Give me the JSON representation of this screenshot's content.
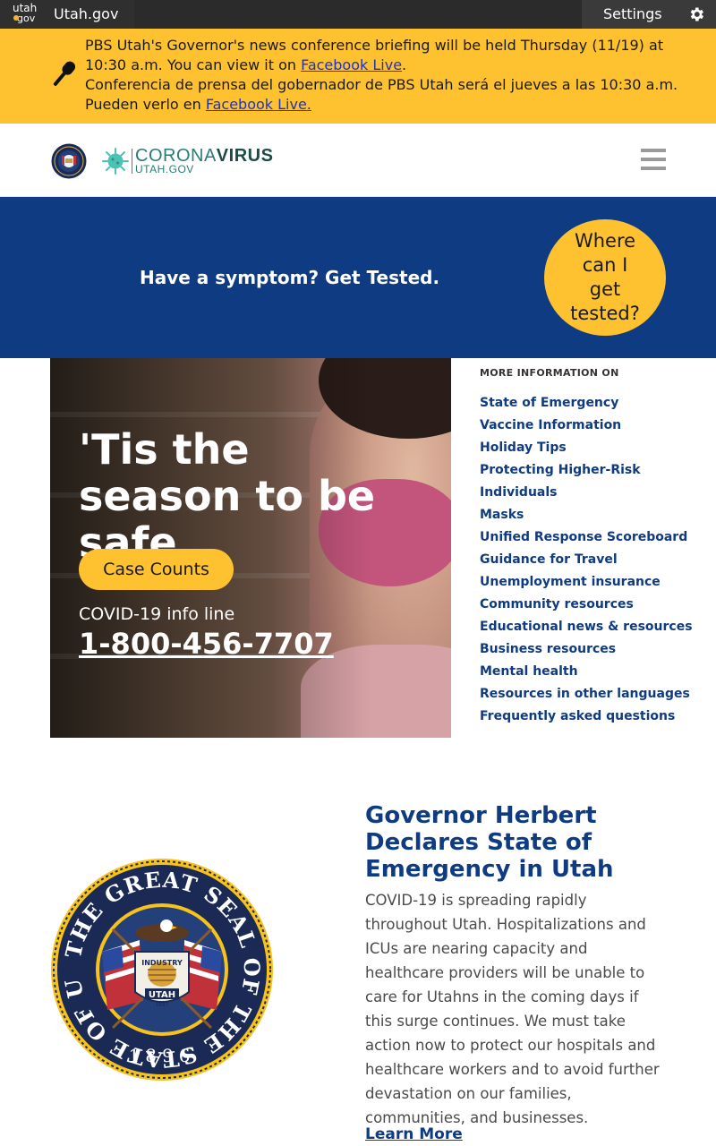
{
  "topbar": {
    "logo_line1": "utah",
    "logo_line2": "gov",
    "site_link": "Utah.gov",
    "settings_label": "Settings"
  },
  "alert": {
    "icon": "microphone-icon",
    "en_text": "PBS Utah's Governor's news conference briefing will be held Thursday (11/19) at 10:30 a.m. You can view it on ",
    "en_link": "Facebook Live",
    "en_suffix": ".",
    "es_text": "Conferencia de prensa del gobernador de PBS Utah será el jueves a las 10:30 a.m. Pueden verlo en ",
    "es_link": "Facebook Live."
  },
  "header": {
    "brand_corona": "CORONA",
    "brand_virus": "VIRUS",
    "brand_sub": "UTAH.GOV"
  },
  "symptom": {
    "text": "Have a symptom? Get Tested.",
    "button": "Where can I get tested?"
  },
  "hero": {
    "title": "'Tis the season to be safe",
    "case_button": "Case Counts",
    "info_label": "COVID-19 info line",
    "phone": "1-800-456-7707"
  },
  "more_info": {
    "title": "MORE INFORMATION ON",
    "items": [
      "State of Emergency",
      "Vaccine Information",
      "Holiday Tips",
      "Protecting Higher-Risk Individuals",
      "Masks",
      "Unified Response Scoreboard",
      "Guidance for Travel",
      "Unemployment insurance",
      "Community resources",
      "Educational news & resources",
      "Business resources",
      "Mental health",
      "Resources in other languages",
      "Frequently asked questions"
    ]
  },
  "seal": {
    "outer_text": "THE GREAT SEAL OF THE STATE OF UTAH",
    "year": "1896",
    "industry": "INDUSTRY",
    "state": "UTAH",
    "founded": "1847"
  },
  "news": {
    "title": "Governor Herbert Declares State of Emergency in Utah",
    "body": "COVID-19 is spreading rapidly throughout Utah. Hospitalizations and ICUs are nearing capacity and healthcare providers will be unable to care for Utahns in the coming days if this surge continues. We must take action now to protect our hospitals and healthcare workers and to avoid further devastation on our families, communities, and businesses.",
    "link": "Learn More"
  },
  "colors": {
    "accent_yellow": "#fec130",
    "brand_blue": "#0f3b82",
    "topbar": "#2b2b2b",
    "teal": "#2a7d76"
  }
}
